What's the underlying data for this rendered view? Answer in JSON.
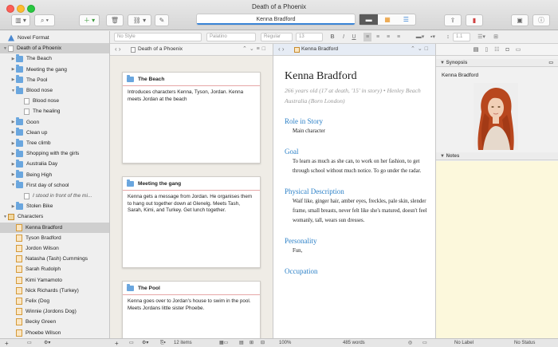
{
  "window": {
    "title": "Death of a Phoenix"
  },
  "toolbar": {
    "document_field": "Kenna Bradford",
    "binder_icon": "binder-icon",
    "search_icon": "search-icon",
    "add_icon": "plus",
    "add_symbol": "+",
    "view_modes": [
      "document",
      "corkboard",
      "outline"
    ]
  },
  "format_bar": {
    "style": "No Style",
    "font": "Palatino",
    "weight": "Regular",
    "size": "13",
    "bold": "B",
    "italic": "I",
    "underline": "U",
    "line_spacing": "1.1"
  },
  "binder": {
    "items": [
      {
        "label": "Novel Format",
        "icon": "format",
        "arrow": "",
        "indent": 0
      },
      {
        "label": "Death of a Phoenix",
        "icon": "doc",
        "arrow": "▼",
        "indent": 0,
        "selected": true
      },
      {
        "label": "The Beach",
        "icon": "folder",
        "arrow": "▶",
        "indent": 1
      },
      {
        "label": "Meeting the gang",
        "icon": "folder",
        "arrow": "▶",
        "indent": 1
      },
      {
        "label": "The Pool",
        "icon": "folder",
        "arrow": "▶",
        "indent": 1
      },
      {
        "label": "Blood nose",
        "icon": "folder",
        "arrow": "▼",
        "indent": 1
      },
      {
        "label": "Blood nose",
        "icon": "doc",
        "arrow": "",
        "indent": 2
      },
      {
        "label": "The healing",
        "icon": "doc",
        "arrow": "",
        "indent": 2
      },
      {
        "label": "Goon",
        "icon": "folder",
        "arrow": "▶",
        "indent": 1
      },
      {
        "label": "Clean up",
        "icon": "folder",
        "arrow": "▶",
        "indent": 1
      },
      {
        "label": "Tree climb",
        "icon": "folder",
        "arrow": "▶",
        "indent": 1
      },
      {
        "label": "Shopping with the girls",
        "icon": "folder",
        "arrow": "▶",
        "indent": 1
      },
      {
        "label": "Australia Day",
        "icon": "folder",
        "arrow": "▶",
        "indent": 1
      },
      {
        "label": "Being High",
        "icon": "folder",
        "arrow": "▶",
        "indent": 1
      },
      {
        "label": "First day of school",
        "icon": "folder",
        "arrow": "▼",
        "indent": 1
      },
      {
        "label": "I stood in front of the mi...",
        "icon": "doc",
        "arrow": "",
        "indent": 2,
        "italic": true
      },
      {
        "label": "Stolen Bike",
        "icon": "folder",
        "arrow": "▶",
        "indent": 1
      },
      {
        "label": "Characters",
        "icon": "chars",
        "arrow": "▼",
        "indent": 0
      },
      {
        "label": "Kenna Bradford",
        "icon": "char",
        "arrow": "",
        "indent": 1,
        "selected": true
      },
      {
        "label": "Tyson Bradford",
        "icon": "char",
        "arrow": "",
        "indent": 1
      },
      {
        "label": "Jordon Wilson",
        "icon": "char",
        "arrow": "",
        "indent": 1
      },
      {
        "label": "Natasha (Tash) Cummings",
        "icon": "char",
        "arrow": "",
        "indent": 1
      },
      {
        "label": "Sarah Rudolph",
        "icon": "char",
        "arrow": "",
        "indent": 1
      },
      {
        "label": "Kimi Yamamoto",
        "icon": "char",
        "arrow": "",
        "indent": 1
      },
      {
        "label": "Nick Richards (Turkey)",
        "icon": "char",
        "arrow": "",
        "indent": 1
      },
      {
        "label": "Felix (Dog",
        "icon": "char",
        "arrow": "",
        "indent": 1
      },
      {
        "label": "Winnie (Jordons Dog)",
        "icon": "char",
        "arrow": "",
        "indent": 1
      },
      {
        "label": "Becky Green",
        "icon": "char",
        "arrow": "",
        "indent": 1
      },
      {
        "label": "Phoebe Wilson",
        "icon": "char",
        "arrow": "",
        "indent": 1
      }
    ]
  },
  "corkboard": {
    "header_title": "Death of a Phoenix",
    "cards": [
      {
        "title": "The Beach",
        "body": "Introduces characters Kenna, Tyson, Jordan. Kenna meets Jordan at the beach"
      },
      {
        "title": "Meeting the gang",
        "body": "Kenna gets a message from Jordan. He organises them to hang out together down at Glenelg. Meets Tash, Sarah, Kimi, and Turkey. Get lunch together."
      },
      {
        "title": "The Pool",
        "body": "Kenna goes over to Jordan's house to swim in the pool. Meets Jordans little sister Phoebe."
      }
    ]
  },
  "document": {
    "header_title": "Kenna Bradford",
    "name": "Kenna Bradford",
    "subtitle": "266 years old (17 at death, '15' in story) • Henley Beach Australia (Born London)",
    "sections": [
      {
        "heading": "Role in Story",
        "text": "Main character"
      },
      {
        "heading": "Goal",
        "text": "To learn as much as she can, to work on her fashion, to get through school without much notice. To go under the radar."
      },
      {
        "heading": "Physical Description",
        "text": "Waif like, ginger hair, amber eyes, freckles, pale skin, slender frame, small breasts, never felt like she's matured, doesn't feel womanly, tall, wears sun dresses."
      },
      {
        "heading": "Personality",
        "text": "Fun,"
      },
      {
        "heading": "Occupation",
        "text": ""
      }
    ]
  },
  "inspector": {
    "synopsis_label": "Synopsis",
    "synopsis_title": "Kenna Bradford",
    "notes_label": "Notes"
  },
  "bottom": {
    "items_count": "12 items",
    "zoom": "100%",
    "word_count": "485 words",
    "label": "No Label",
    "status": "No Status"
  },
  "colors": {
    "accent": "#2e82c8",
    "notes_bg": "#fcf8dc",
    "card_rule": "#e6a6a6"
  }
}
